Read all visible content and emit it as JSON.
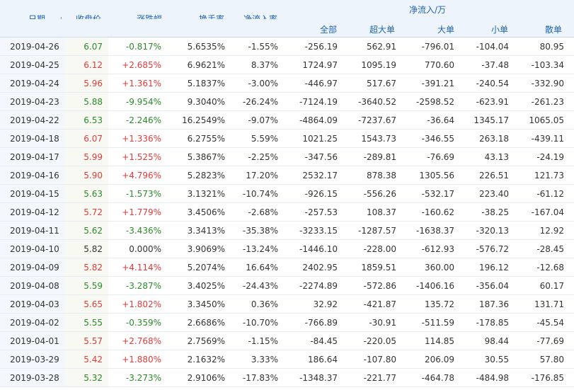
{
  "headers": {
    "date": "日期",
    "close": "收盘价",
    "change": "涨跌幅",
    "turnover": "换手率",
    "net_ratio": "净流入率",
    "net_flow_group": "净流入/万",
    "all": "全部",
    "super_large": "超大单",
    "large": "大单",
    "small": "小单",
    "retail": "散单"
  },
  "sort_icon": "arrow-down-icon",
  "colors": {
    "up": "#e33b3b",
    "down": "#2c8a2c",
    "header_text": "#1e63b8",
    "header_bg": "#eef4fb"
  },
  "rows": [
    {
      "date": "2019-04-26",
      "close": "6.07",
      "change": "-0.817%",
      "turnover": "5.6535%",
      "net_ratio": "-1.55%",
      "all": "-256.19",
      "super_large": "562.91",
      "large": "-796.01",
      "small": "-104.04",
      "retail": "80.95",
      "trend": "down"
    },
    {
      "date": "2019-04-25",
      "close": "6.12",
      "change": "+2.685%",
      "turnover": "6.9621%",
      "net_ratio": "8.37%",
      "all": "1724.97",
      "super_large": "1095.19",
      "large": "770.60",
      "small": "-37.48",
      "retail": "-103.34",
      "trend": "up"
    },
    {
      "date": "2019-04-24",
      "close": "5.96",
      "change": "+1.361%",
      "turnover": "5.1837%",
      "net_ratio": "-3.00%",
      "all": "-446.97",
      "super_large": "517.67",
      "large": "-391.21",
      "small": "-240.54",
      "retail": "-332.90",
      "trend": "up"
    },
    {
      "date": "2019-04-23",
      "close": "5.88",
      "change": "-9.954%",
      "turnover": "9.3040%",
      "net_ratio": "-26.24%",
      "all": "-7124.19",
      "super_large": "-3640.52",
      "large": "-2598.52",
      "small": "-623.91",
      "retail": "-261.23",
      "trend": "down"
    },
    {
      "date": "2019-04-22",
      "close": "6.53",
      "change": "-2.246%",
      "turnover": "16.2549%",
      "net_ratio": "-9.07%",
      "all": "-4864.09",
      "super_large": "-7237.67",
      "large": "-36.64",
      "small": "1345.17",
      "retail": "1065.05",
      "trend": "down"
    },
    {
      "date": "2019-04-18",
      "close": "6.07",
      "change": "+1.336%",
      "turnover": "6.2755%",
      "net_ratio": "5.59%",
      "all": "1021.25",
      "super_large": "1543.73",
      "large": "-346.55",
      "small": "263.18",
      "retail": "-439.11",
      "trend": "up"
    },
    {
      "date": "2019-04-17",
      "close": "5.99",
      "change": "+1.525%",
      "turnover": "5.3867%",
      "net_ratio": "-2.25%",
      "all": "-347.56",
      "super_large": "-289.81",
      "large": "-76.69",
      "small": "43.13",
      "retail": "-24.19",
      "trend": "up"
    },
    {
      "date": "2019-04-16",
      "close": "5.90",
      "change": "+4.796%",
      "turnover": "5.2823%",
      "net_ratio": "17.20%",
      "all": "2532.17",
      "super_large": "878.38",
      "large": "1305.56",
      "small": "226.51",
      "retail": "121.73",
      "trend": "up"
    },
    {
      "date": "2019-04-15",
      "close": "5.63",
      "change": "-1.573%",
      "turnover": "3.1321%",
      "net_ratio": "-10.74%",
      "all": "-926.15",
      "super_large": "-556.26",
      "large": "-532.17",
      "small": "223.40",
      "retail": "-61.12",
      "trend": "down"
    },
    {
      "date": "2019-04-12",
      "close": "5.72",
      "change": "+1.779%",
      "turnover": "3.4506%",
      "net_ratio": "-2.68%",
      "all": "-257.53",
      "super_large": "108.37",
      "large": "-160.62",
      "small": "-38.25",
      "retail": "-167.04",
      "trend": "up"
    },
    {
      "date": "2019-04-11",
      "close": "5.62",
      "change": "-3.436%",
      "turnover": "3.3413%",
      "net_ratio": "-35.38%",
      "all": "-3233.15",
      "super_large": "-1287.57",
      "large": "-1638.37",
      "small": "-320.13",
      "retail": "12.92",
      "trend": "down"
    },
    {
      "date": "2019-04-10",
      "close": "5.82",
      "change": "0.000%",
      "turnover": "3.9069%",
      "net_ratio": "-13.24%",
      "all": "-1446.10",
      "super_large": "-228.00",
      "large": "-612.93",
      "small": "-576.72",
      "retail": "-28.45",
      "trend": "neutral"
    },
    {
      "date": "2019-04-09",
      "close": "5.82",
      "change": "+4.114%",
      "turnover": "5.2074%",
      "net_ratio": "16.64%",
      "all": "2402.95",
      "super_large": "1859.51",
      "large": "360.00",
      "small": "196.12",
      "retail": "-12.68",
      "trend": "up"
    },
    {
      "date": "2019-04-08",
      "close": "5.59",
      "change": "-3.287%",
      "turnover": "3.4025%",
      "net_ratio": "-24.43%",
      "all": "-2274.89",
      "super_large": "-572.86",
      "large": "-1406.16",
      "small": "-356.04",
      "retail": "60.17",
      "trend": "down"
    },
    {
      "date": "2019-04-03",
      "close": "5.65",
      "change": "+1.802%",
      "turnover": "3.3450%",
      "net_ratio": "0.36%",
      "all": "32.92",
      "super_large": "-421.87",
      "large": "135.72",
      "small": "187.36",
      "retail": "131.71",
      "trend": "up"
    },
    {
      "date": "2019-04-02",
      "close": "5.55",
      "change": "-0.359%",
      "turnover": "2.6686%",
      "net_ratio": "-10.70%",
      "all": "-766.89",
      "super_large": "-30.91",
      "large": "-511.59",
      "small": "-178.85",
      "retail": "-45.54",
      "trend": "down"
    },
    {
      "date": "2019-04-01",
      "close": "5.57",
      "change": "+2.768%",
      "turnover": "2.7569%",
      "net_ratio": "-1.15%",
      "all": "-84.45",
      "super_large": "-220.05",
      "large": "114.85",
      "small": "98.44",
      "retail": "-77.69",
      "trend": "up"
    },
    {
      "date": "2019-03-29",
      "close": "5.42",
      "change": "+1.880%",
      "turnover": "2.1632%",
      "net_ratio": "3.33%",
      "all": "186.64",
      "super_large": "-107.80",
      "large": "206.09",
      "small": "30.55",
      "retail": "57.80",
      "trend": "up"
    },
    {
      "date": "2019-03-28",
      "close": "5.32",
      "change": "-3.273%",
      "turnover": "2.9106%",
      "net_ratio": "-17.83%",
      "all": "-1348.37",
      "super_large": "-221.77",
      "large": "-464.78",
      "small": "-484.98",
      "retail": "-176.85",
      "trend": "down"
    }
  ]
}
